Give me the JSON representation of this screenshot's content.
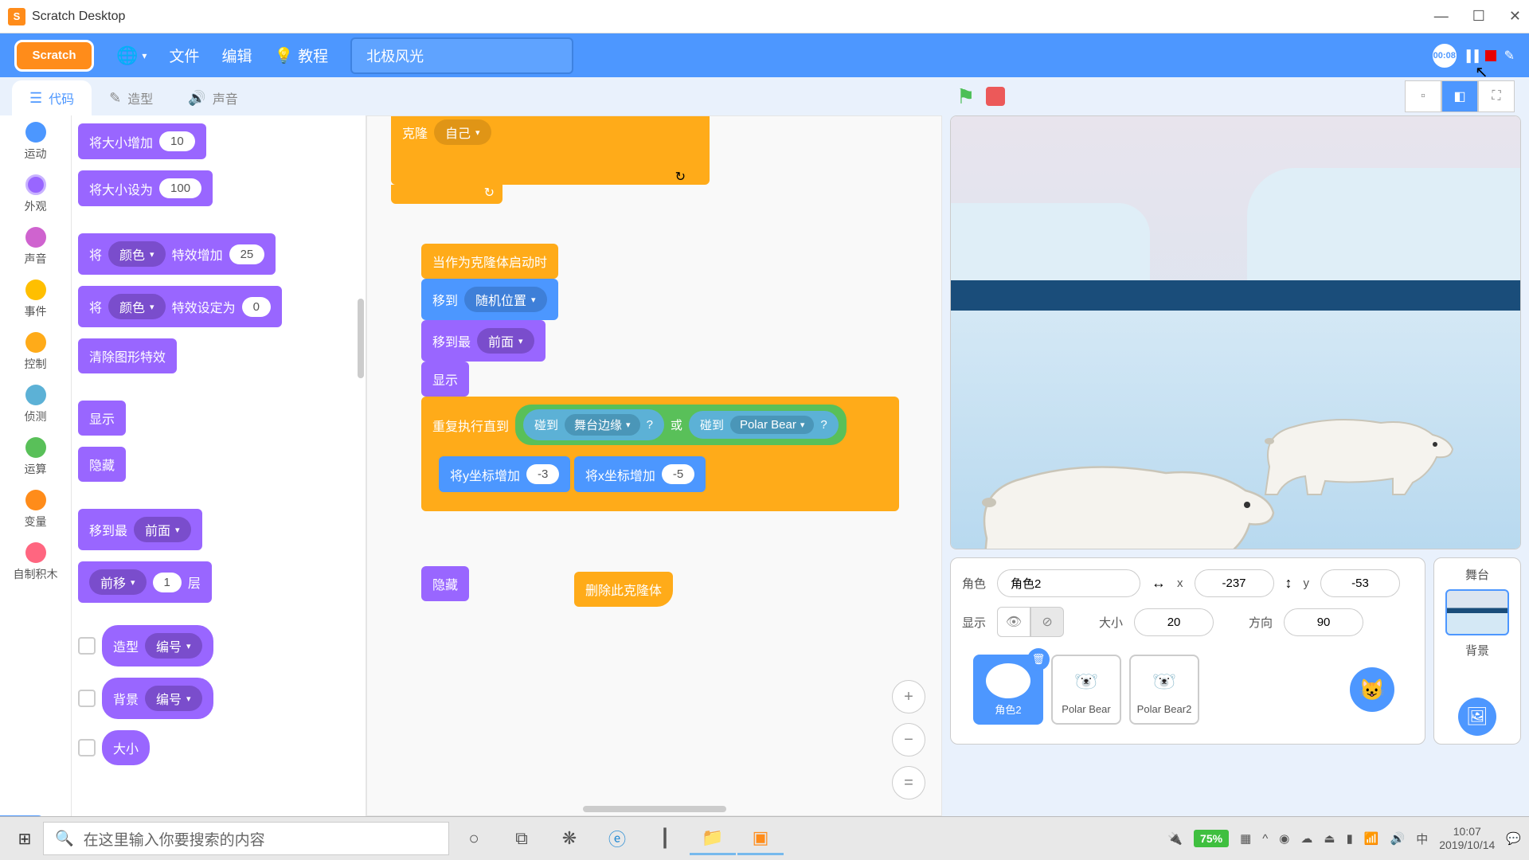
{
  "window": {
    "title": "Scratch Desktop"
  },
  "menubar": {
    "logo": "Scratch",
    "file": "文件",
    "edit": "编辑",
    "tutorials": "教程",
    "project_name": "北极风光",
    "timer": "00:08"
  },
  "tabs": {
    "code": "代码",
    "costumes": "造型",
    "sounds": "声音"
  },
  "categories": {
    "motion": "运动",
    "looks": "外观",
    "sound": "声音",
    "events": "事件",
    "control": "控制",
    "sensing": "侦测",
    "operators": "运算",
    "variables": "变量",
    "myblocks": "自制积木"
  },
  "palette": {
    "change_size_by": "将大小增加",
    "change_size_val": "10",
    "set_size_to": "将大小设为",
    "set_size_val": "100",
    "set_effect_prefix": "将",
    "color_drop": "颜色",
    "effect_increase": "特效增加",
    "effect_increase_val": "25",
    "effect_set": "特效设定为",
    "effect_set_val": "0",
    "clear_effects": "清除图形特效",
    "show": "显示",
    "hide": "隐藏",
    "goto_layer": "移到最",
    "front": "前面",
    "go_layers_prefix": "前移",
    "go_layers_val": "1",
    "go_layers_suffix": "层",
    "costume_drop": "造型",
    "number_drop": "编号",
    "backdrop_drop": "背景",
    "size_reporter": "大小"
  },
  "workspace": {
    "clone": "克隆",
    "myself": "自己",
    "when_clone": "当作为克隆体启动时",
    "goto": "移到",
    "random_pos": "随机位置",
    "goto_layer": "移到最",
    "front": "前面",
    "show": "显示",
    "repeat_until": "重复执行直到",
    "touching": "碰到",
    "stage_edge": "舞台边缘",
    "question": "?",
    "or": "或",
    "polar_bear": "Polar Bear",
    "change_y": "将y坐标增加",
    "y_val": "-3",
    "change_x": "将x坐标增加",
    "x_val": "-5",
    "hide": "隐藏",
    "delete_clone": "删除此克隆体"
  },
  "sprite_info": {
    "sprite_label": "角色",
    "sprite_name": "角色2",
    "x_label": "x",
    "x_val": "-237",
    "y_label": "y",
    "y_val": "-53",
    "show_label": "显示",
    "size_label": "大小",
    "size_val": "20",
    "direction_label": "方向",
    "direction_val": "90"
  },
  "sprites": {
    "sprite1": "角色2",
    "sprite2": "Polar Bear",
    "sprite3": "Polar Bear2"
  },
  "stage_panel": {
    "stage_label": "舞台",
    "backdrop_label": "背景"
  },
  "taskbar": {
    "search_placeholder": "在这里输入你要搜索的内容",
    "battery": "75%",
    "ime": "中",
    "time": "10:07",
    "date": "2019/10/14"
  }
}
